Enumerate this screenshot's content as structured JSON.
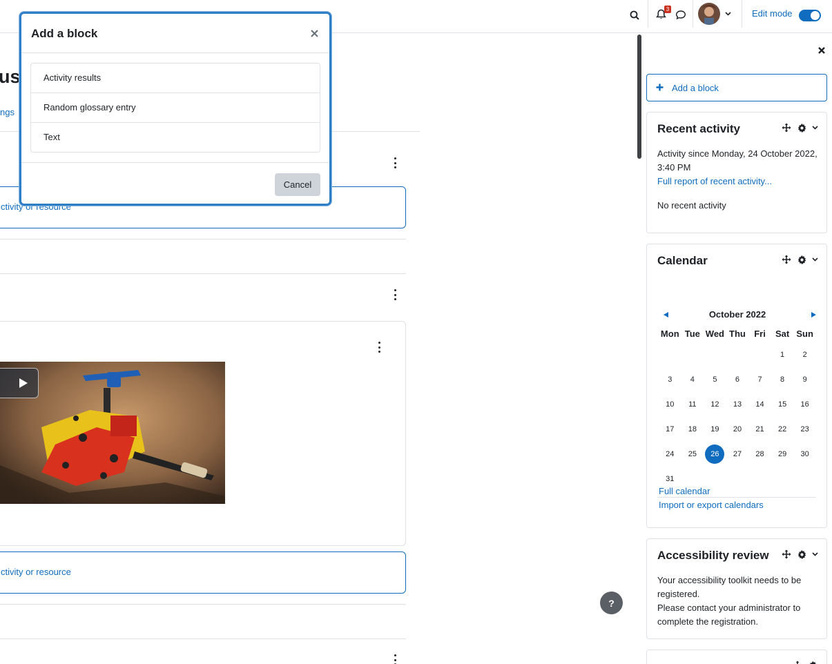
{
  "navbar": {
    "notification_count": "3",
    "edit_mode_label": "Edit mode",
    "icons": [
      "search-icon",
      "bell-icon",
      "chat-icon",
      "chevron-down-icon"
    ]
  },
  "page": {
    "title_fragment": "us",
    "tab_fragment": "ngs",
    "add_activity_fragment_1": "ctivity or resource",
    "add_activity_fragment_2": "ctivity or resource"
  },
  "drawer": {
    "add_block_label": "Add a block",
    "recent_activity": {
      "title": "Recent activity",
      "since_text": "Activity since Monday, 24 October 2022, 3:40 PM",
      "full_report_link": "Full report of recent activity...",
      "no_activity": "No recent activity"
    },
    "calendar": {
      "title": "Calendar",
      "month_label": "October 2022",
      "weekdays": [
        "Mon",
        "Tue",
        "Wed",
        "Thu",
        "Fri",
        "Sat",
        "Sun"
      ],
      "weeks": [
        [
          "",
          "",
          "",
          "",
          "",
          "1",
          "2"
        ],
        [
          "3",
          "4",
          "5",
          "6",
          "7",
          "8",
          "9"
        ],
        [
          "10",
          "11",
          "12",
          "13",
          "14",
          "15",
          "16"
        ],
        [
          "17",
          "18",
          "19",
          "20",
          "21",
          "22",
          "23"
        ],
        [
          "24",
          "25",
          "26",
          "27",
          "28",
          "29",
          "30"
        ],
        [
          "31",
          "",
          "",
          "",
          "",
          "",
          ""
        ]
      ],
      "today": "26",
      "full_calendar_link": "Full calendar",
      "import_export_link": "Import or export calendars"
    },
    "accessibility": {
      "title": "Accessibility review",
      "line1": "Your accessibility toolkit needs to be registered.",
      "line2": "Please contact your administrator to complete the registration."
    }
  },
  "modal": {
    "title": "Add a block",
    "options": [
      "Activity results",
      "Random glossary entry",
      "Text"
    ],
    "cancel_label": "Cancel"
  },
  "help_label": "?",
  "colors": {
    "primary": "#0f6cbf",
    "badge": "#ca3120",
    "border": "#dee2e6"
  }
}
